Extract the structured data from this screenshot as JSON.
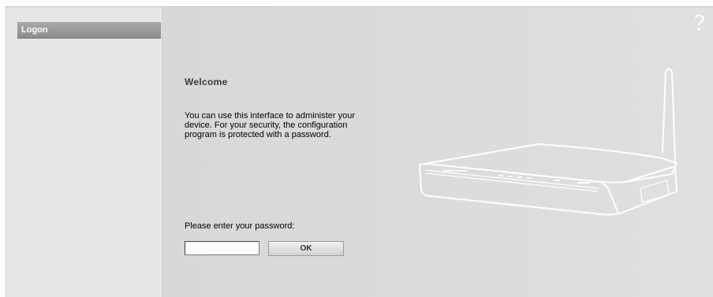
{
  "sidebar": {
    "items": [
      {
        "label": "Logon"
      }
    ]
  },
  "header": {
    "help_symbol": "?"
  },
  "main": {
    "title": "Welcome",
    "intro": "You can use this interface to administer your device. For your security, the configuration program is protected with a password.",
    "password_label": "Please enter your password:",
    "password_value": "",
    "ok_label": "OK"
  },
  "icons": {
    "help": "question-mark-icon",
    "device": "router-illustration"
  }
}
